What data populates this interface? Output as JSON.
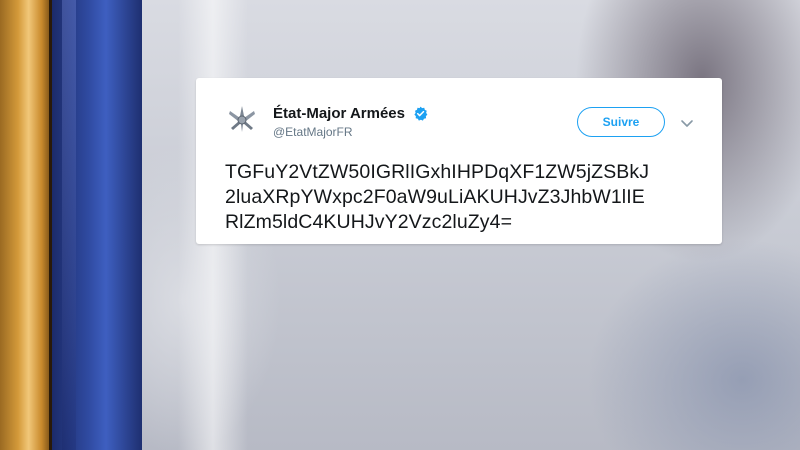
{
  "tweet": {
    "author_name": "État-Major Armées",
    "author_handle": "@EtatMajorFR",
    "verified": true,
    "follow_label": "Suivre",
    "body_lines": [
      "TGFuY2VtZW50IGRlIGxhIHPDqXF1ZW5jZSBkJ",
      "2luaXRpYWxpc2F0aW9uLiAKUHJvZ3JhbW1lIE",
      "RlZm5ldC4KUHJvY2Vzc2luZy4="
    ]
  },
  "colors": {
    "accent": "#1da1f2",
    "text": "#14171a",
    "muted": "#657786"
  },
  "icons": {
    "avatar": "military-insignia-icon",
    "verified": "verified-badge-icon",
    "menu": "chevron-down-icon"
  }
}
